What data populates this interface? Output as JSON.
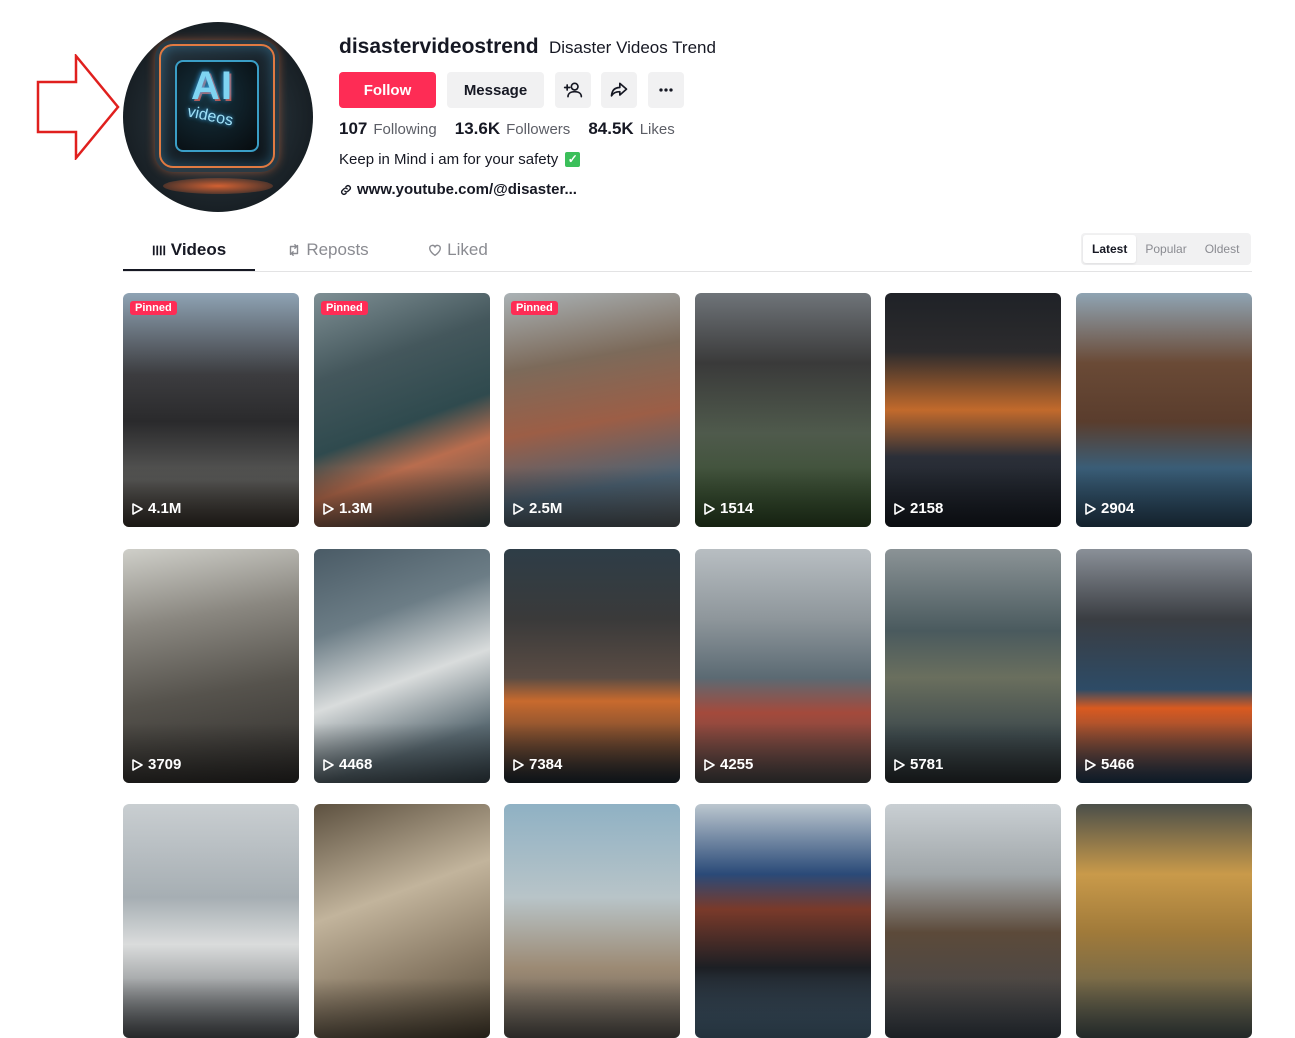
{
  "profile": {
    "username": "disastervideostrend",
    "nickname": "Disaster Videos Trend",
    "avatar_text_main": "AI",
    "avatar_text_sub": "videos",
    "bio": "Keep in Mind i am for your safety",
    "link": "www.youtube.com/@disaster..."
  },
  "actions": {
    "follow": "Follow",
    "message": "Message"
  },
  "stats": [
    {
      "value": "107",
      "label": "Following"
    },
    {
      "value": "13.6K",
      "label": "Followers"
    },
    {
      "value": "84.5K",
      "label": "Likes"
    }
  ],
  "tabs": [
    {
      "label": "Videos",
      "icon": "grid-icon",
      "active": true
    },
    {
      "label": "Reposts",
      "icon": "repost-icon",
      "active": false
    },
    {
      "label": "Liked",
      "icon": "liked-heart-icon",
      "active": false
    }
  ],
  "sort": {
    "options": [
      "Latest",
      "Popular",
      "Oldest"
    ],
    "selected": "Latest"
  },
  "colors": {
    "accent": "#fe2c55",
    "annotation_arrow": "#e0201e"
  },
  "pinned_label": "Pinned",
  "videos": [
    {
      "views": "4.1M",
      "pinned": true,
      "scene": "volcano-eruption-town",
      "bg": "linear-gradient(180deg,#8fa3b4 0%,#3c3c3f 35%,#2a2a2c 55%,#5a5a58 80%,#3b342d 100%)"
    },
    {
      "views": "1.3M",
      "pinned": true,
      "scene": "ship-dock-crash",
      "bg": "linear-gradient(160deg,#7e8f94 0%,#44575c 30%,#2f4a4e 55%,#b96d4e 70%,#3d4d4f 100%)"
    },
    {
      "views": "2.5M",
      "pinned": true,
      "scene": "container-stack-collapse",
      "bg": "linear-gradient(170deg,#aab2b5 0%,#7c6a5a 30%,#9c5e46 55%,#4d6374 80%,#5a5f62 100%)"
    },
    {
      "views": "1514",
      "pinned": false,
      "scene": "volcano-ash-forest",
      "bg": "linear-gradient(180deg,#6f7479 0%,#3a3a3a 30%,#4f5a4c 60%,#2f4a26 100%)"
    },
    {
      "views": "2158",
      "pinned": false,
      "scene": "volcano-sunset",
      "bg": "linear-gradient(180deg,#1f2227 0%,#2c2b2d 25%,#c26a2c 50%,#2b2f38 70%,#171c24 100%)"
    },
    {
      "views": "2904",
      "pinned": false,
      "scene": "cars-falling-from-ship",
      "bg": "linear-gradient(180deg,#8fa4b3 0%,#6a4a36 30%,#5a3d2d 55%,#3a5e78 75%,#2c4a62 100%)"
    },
    {
      "views": "3709",
      "pinned": false,
      "scene": "warship-wreck",
      "bg": "linear-gradient(170deg,#cfcfc9 0%,#8a8780 30%,#56534d 60%,#2e2c2a 100%)"
    },
    {
      "views": "4468",
      "pinned": false,
      "scene": "cruise-ship-marina",
      "bg": "linear-gradient(160deg,#4a5b66 0%,#6c7d86 30%,#d9dcdc 55%,#5d6d75 80%,#3a4850 100%)"
    },
    {
      "views": "7384",
      "pinned": false,
      "scene": "ocean-volcano-plume",
      "bg": "linear-gradient(180deg,#2e3d47 0%,#3a3a3a 30%,#5a4c44 55%,#c86a2e 65%,#1e2a33 100%)"
    },
    {
      "views": "4255",
      "pinned": false,
      "scene": "ship-through-window",
      "bg": "linear-gradient(180deg,#b8bec2 0%,#8e969b 30%,#5b6a73 55%,#a44a3c 70%,#4a4a4a 100%)"
    },
    {
      "views": "5781",
      "pinned": false,
      "scene": "cargo-ship-skyscraper",
      "bg": "linear-gradient(180deg,#8b9396 0%,#4a5a5e 35%,#6a6f5e 55%,#3e4a4d 80%,#2a2f31 100%)"
    },
    {
      "views": "5466",
      "pinned": false,
      "scene": "sea-fire-plume",
      "bg": "linear-gradient(180deg,#8a9098 0%,#3a3d42 30%,#2d4b66 60%,#d95a20 68%,#1d3a55 100%)"
    },
    {
      "views": "",
      "pinned": false,
      "scene": "cruise-ship-crowd",
      "bg": "linear-gradient(180deg,#c9ced1 0%,#a6aeb3 40%,#dadcdc 60%,#55595d 100%)"
    },
    {
      "views": "",
      "pinned": false,
      "scene": "landslide-cliff",
      "bg": "linear-gradient(160deg,#5d5140 0%,#c2b49c 40%,#8a7b66 70%,#4e4434 100%)"
    },
    {
      "views": "",
      "pinned": false,
      "scene": "collapsing-tower",
      "bg": "linear-gradient(180deg,#8fb1c4 0%,#b8c4c8 40%,#9c8a74 70%,#5e5a55 100%)"
    },
    {
      "views": "",
      "pinned": false,
      "scene": "container-ship-bow",
      "bg": "linear-gradient(180deg,#bcc7cf 0%,#2a4a78 30%,#7a3a2a 45%,#1c1f24 70%,#4f6e86 100%)"
    },
    {
      "views": "",
      "pinned": false,
      "scene": "bridge-collapse-crane",
      "bg": "linear-gradient(180deg,#c9cfd3 0%,#a0a6a9 30%,#5c4a3a 55%,#3d4650 100%)"
    },
    {
      "views": "",
      "pinned": false,
      "scene": "container-crane-dock",
      "bg": "linear-gradient(180deg,#4b4f4a 0%,#c99a4a 30%,#a07a3a 55%,#4e5a58 100%)"
    }
  ]
}
